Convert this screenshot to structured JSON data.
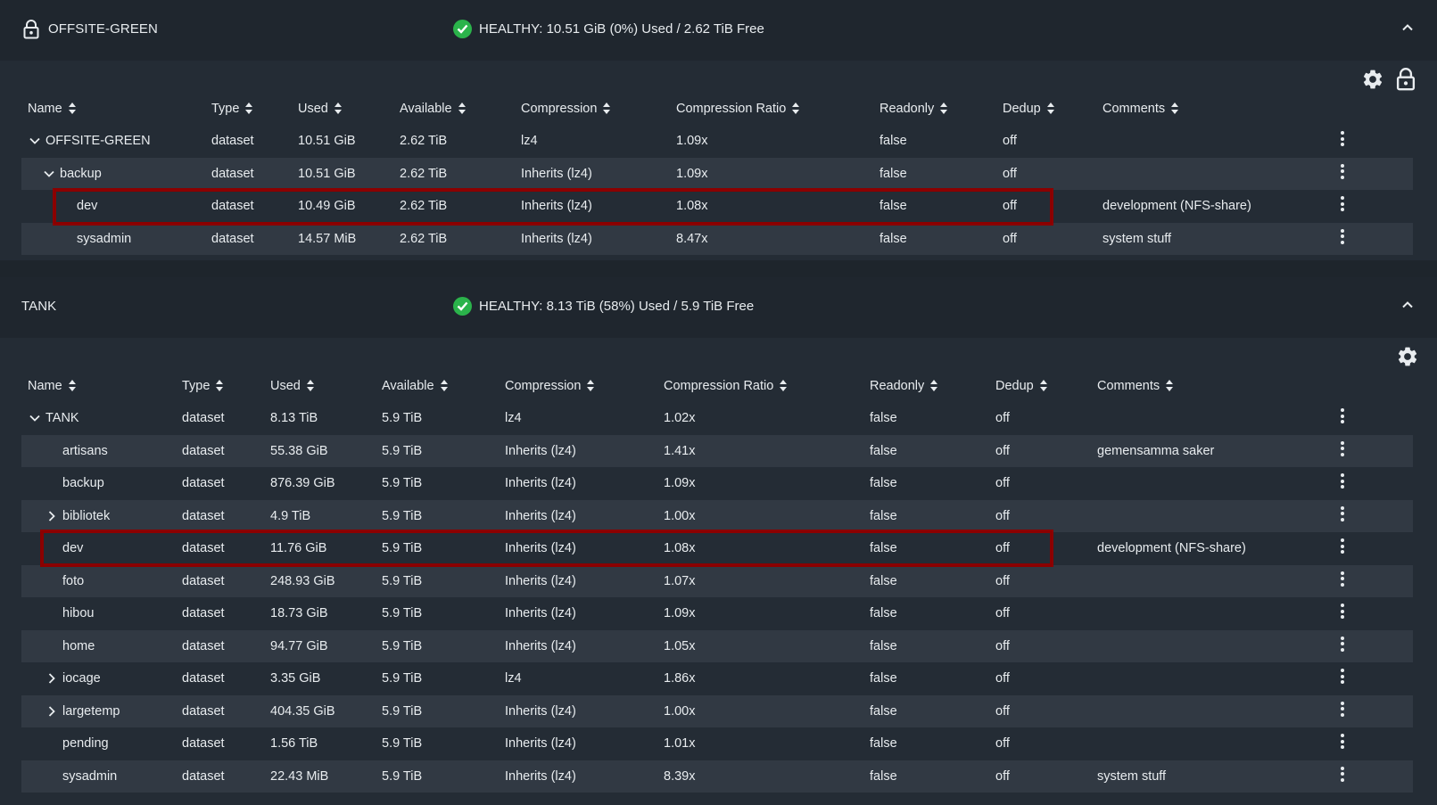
{
  "pools": [
    {
      "title": "OFFSITE-GREEN",
      "health": "HEALTHY: 10.51 GiB (0%) Used / 2.62 TiB Free",
      "columns": [
        "Name",
        "Type",
        "Used",
        "Available",
        "Compression",
        "Compression Ratio",
        "Readonly",
        "Dedup",
        "Comments"
      ],
      "rows": [
        {
          "name": "OFFSITE-GREEN",
          "type": "dataset",
          "used": "10.51 GiB",
          "available": "2.62 TiB",
          "compression": "lz4",
          "ratio": "1.09x",
          "readonly": "false",
          "dedup": "off",
          "comments": "",
          "expand": "expanded"
        },
        {
          "name": "backup",
          "type": "dataset",
          "used": "10.51 GiB",
          "available": "2.62 TiB",
          "compression": "Inherits (lz4)",
          "ratio": "1.09x",
          "readonly": "false",
          "dedup": "off",
          "comments": "",
          "expand": "expanded"
        },
        {
          "name": "dev",
          "type": "dataset",
          "used": "10.49 GiB",
          "available": "2.62 TiB",
          "compression": "Inherits (lz4)",
          "ratio": "1.08x",
          "readonly": "false",
          "dedup": "off",
          "comments": "development (NFS-share)",
          "expand": "none"
        },
        {
          "name": "sysadmin",
          "type": "dataset",
          "used": "14.57 MiB",
          "available": "2.62 TiB",
          "compression": "Inherits (lz4)",
          "ratio": "8.47x",
          "readonly": "false",
          "dedup": "off",
          "comments": "system stuff",
          "expand": "none"
        }
      ]
    },
    {
      "title": "TANK",
      "health": "HEALTHY: 8.13 TiB (58%) Used / 5.9 TiB Free",
      "columns": [
        "Name",
        "Type",
        "Used",
        "Available",
        "Compression",
        "Compression Ratio",
        "Readonly",
        "Dedup",
        "Comments"
      ],
      "rows": [
        {
          "name": "TANK",
          "type": "dataset",
          "used": "8.13 TiB",
          "available": "5.9 TiB",
          "compression": "lz4",
          "ratio": "1.02x",
          "readonly": "false",
          "dedup": "off",
          "comments": "",
          "expand": "expanded"
        },
        {
          "name": "artisans",
          "type": "dataset",
          "used": "55.38 GiB",
          "available": "5.9 TiB",
          "compression": "Inherits (lz4)",
          "ratio": "1.41x",
          "readonly": "false",
          "dedup": "off",
          "comments": "gemensamma saker",
          "expand": "none"
        },
        {
          "name": "backup",
          "type": "dataset",
          "used": "876.39 GiB",
          "available": "5.9 TiB",
          "compression": "Inherits (lz4)",
          "ratio": "1.09x",
          "readonly": "false",
          "dedup": "off",
          "comments": "",
          "expand": "none"
        },
        {
          "name": "bibliotek",
          "type": "dataset",
          "used": "4.9 TiB",
          "available": "5.9 TiB",
          "compression": "Inherits (lz4)",
          "ratio": "1.00x",
          "readonly": "false",
          "dedup": "off",
          "comments": "",
          "expand": "collapsed"
        },
        {
          "name": "dev",
          "type": "dataset",
          "used": "11.76 GiB",
          "available": "5.9 TiB",
          "compression": "Inherits (lz4)",
          "ratio": "1.08x",
          "readonly": "false",
          "dedup": "off",
          "comments": "development (NFS-share)",
          "expand": "none"
        },
        {
          "name": "foto",
          "type": "dataset",
          "used": "248.93 GiB",
          "available": "5.9 TiB",
          "compression": "Inherits (lz4)",
          "ratio": "1.07x",
          "readonly": "false",
          "dedup": "off",
          "comments": "",
          "expand": "none"
        },
        {
          "name": "hibou",
          "type": "dataset",
          "used": "18.73 GiB",
          "available": "5.9 TiB",
          "compression": "Inherits (lz4)",
          "ratio": "1.09x",
          "readonly": "false",
          "dedup": "off",
          "comments": "",
          "expand": "none"
        },
        {
          "name": "home",
          "type": "dataset",
          "used": "94.77 GiB",
          "available": "5.9 TiB",
          "compression": "Inherits (lz4)",
          "ratio": "1.05x",
          "readonly": "false",
          "dedup": "off",
          "comments": "",
          "expand": "none"
        },
        {
          "name": "iocage",
          "type": "dataset",
          "used": "3.35 GiB",
          "available": "5.9 TiB",
          "compression": "lz4",
          "ratio": "1.86x",
          "readonly": "false",
          "dedup": "off",
          "comments": "",
          "expand": "collapsed"
        },
        {
          "name": "largetemp",
          "type": "dataset",
          "used": "404.35 GiB",
          "available": "5.9 TiB",
          "compression": "Inherits (lz4)",
          "ratio": "1.00x",
          "readonly": "false",
          "dedup": "off",
          "comments": "",
          "expand": "collapsed"
        },
        {
          "name": "pending",
          "type": "dataset",
          "used": "1.56 TiB",
          "available": "5.9 TiB",
          "compression": "Inherits (lz4)",
          "ratio": "1.01x",
          "readonly": "false",
          "dedup": "off",
          "comments": "",
          "expand": "none"
        },
        {
          "name": "sysadmin",
          "type": "dataset",
          "used": "22.43 MiB",
          "available": "5.9 TiB",
          "compression": "Inherits (lz4)",
          "ratio": "8.39x",
          "readonly": "false",
          "dedup": "off",
          "comments": "system stuff",
          "expand": "none"
        }
      ]
    }
  ],
  "colors": {
    "healthy": "#2bb34b",
    "highlight": "#8b0000"
  },
  "icons": {
    "lock": "lock-icon",
    "gear": "gear-icon",
    "check": "check-circle-icon",
    "collapse": "chevron-up-icon",
    "more": "more-vert-icon"
  }
}
